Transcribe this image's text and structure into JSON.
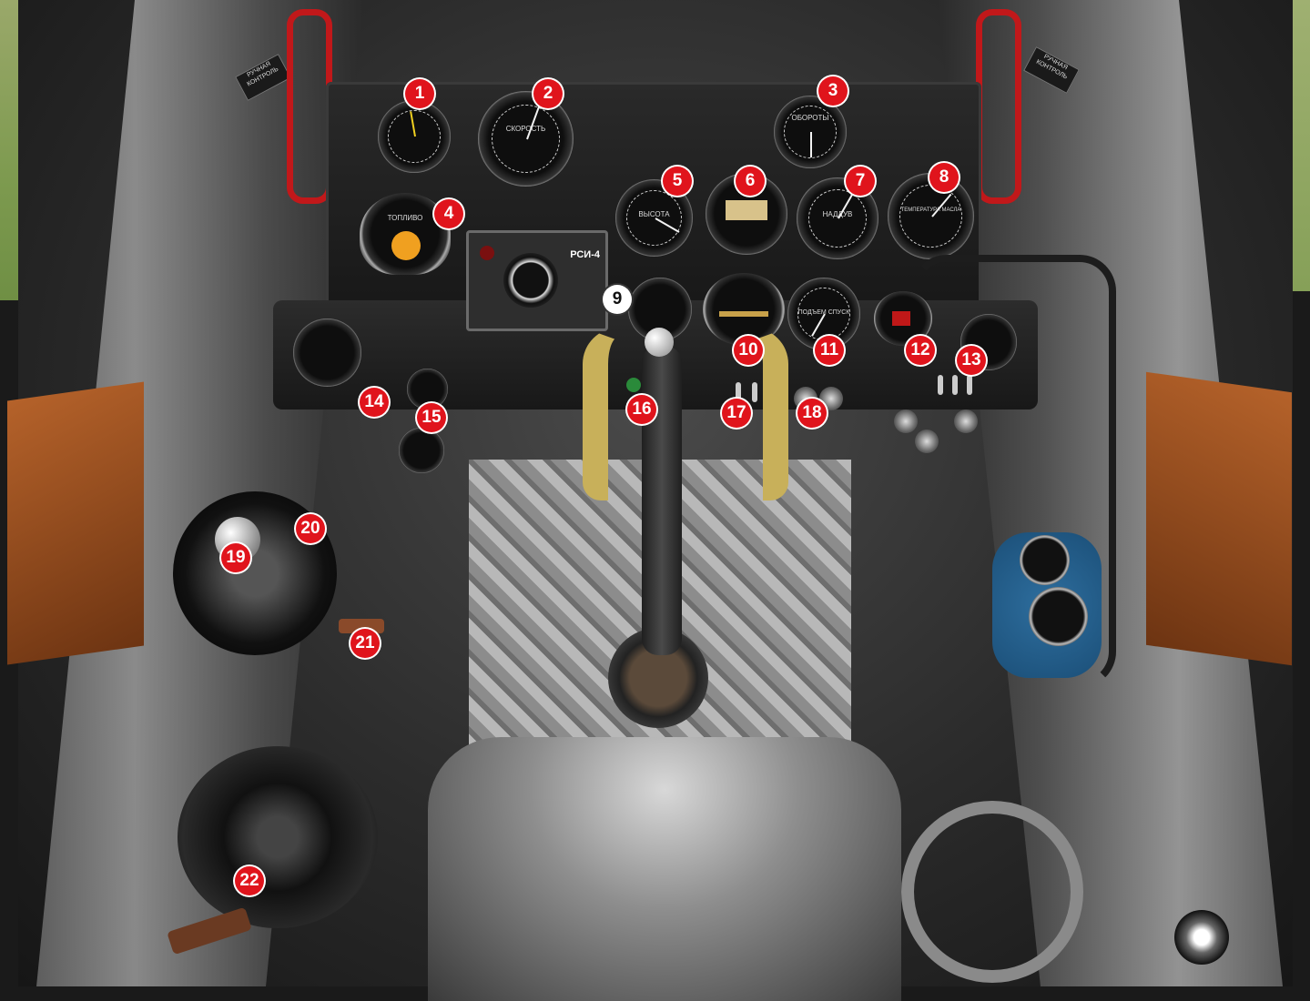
{
  "scene": {
    "panel_label": "РСИ-4",
    "placard_left": "РУЧНАЯ КОНТРОЛЬ",
    "placard_right": "РУЧНАЯ КОНТРОЛЬ",
    "gauge_labels": {
      "airspeed": "СКОРОСТЬ",
      "altimeter": "ВЫСОТА",
      "tachometer": "ОБОРОТЫ",
      "fuel": "ТОПЛИВО",
      "manifold": "НАДДУВ",
      "temperature": "ТЕМПЕРАТУРА МАСЛА",
      "climb": "ПОДЪЕМ СПУСК"
    }
  },
  "callouts": [
    {
      "n": "1",
      "style": "red"
    },
    {
      "n": "2",
      "style": "red"
    },
    {
      "n": "3",
      "style": "red"
    },
    {
      "n": "4",
      "style": "red"
    },
    {
      "n": "5",
      "style": "red"
    },
    {
      "n": "6",
      "style": "red"
    },
    {
      "n": "7",
      "style": "red"
    },
    {
      "n": "8",
      "style": "red"
    },
    {
      "n": "9",
      "style": "white"
    },
    {
      "n": "10",
      "style": "red"
    },
    {
      "n": "11",
      "style": "red"
    },
    {
      "n": "12",
      "style": "red"
    },
    {
      "n": "13",
      "style": "red"
    },
    {
      "n": "14",
      "style": "red"
    },
    {
      "n": "15",
      "style": "red"
    },
    {
      "n": "16",
      "style": "red"
    },
    {
      "n": "17",
      "style": "red"
    },
    {
      "n": "18",
      "style": "red"
    },
    {
      "n": "19",
      "style": "red"
    },
    {
      "n": "20",
      "style": "red"
    },
    {
      "n": "21",
      "style": "red"
    },
    {
      "n": "22",
      "style": "red"
    }
  ],
  "colors": {
    "callout_red": "#e0141c",
    "handle_red": "#c1181a",
    "yoke_gold": "#c8b05a",
    "oxygen_blue": "#2e6e9e",
    "topbar_teal": "#1b8fa0"
  }
}
